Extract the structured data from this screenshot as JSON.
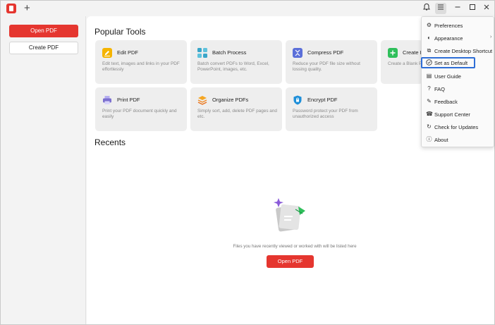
{
  "titlebar": {
    "new_tab_symbol": "+",
    "icons": [
      "pdf-app-logo",
      "bell-icon",
      "menu-icon",
      "minimize-icon",
      "maximize-icon",
      "close-icon"
    ]
  },
  "sidebar": {
    "open_pdf": "Open PDF",
    "create_pdf": "Create PDF"
  },
  "main": {
    "popular_tools_title": "Popular Tools",
    "tools": [
      {
        "title": "Edit PDF",
        "desc": "Edit text, images and links in your PDF effortlessly",
        "icon": "edit-icon",
        "color": "#f5b400"
      },
      {
        "title": "Batch Process",
        "desc": "Batch convert PDFs to Word, Excel, PowerPoint, images, etc.",
        "icon": "batch-icon",
        "color": "#3aa6c9"
      },
      {
        "title": "Compress PDF",
        "desc": "Reduce your PDF file size without lossing quality.",
        "icon": "compress-icon",
        "color": "#5b6fd9"
      },
      {
        "title": "Create PDF",
        "desc": "Create a Blank PDF",
        "icon": "create-icon",
        "color": "#2fbf5b"
      },
      {
        "title": "Print PDF",
        "desc": "Print your PDF document quickly and easily",
        "icon": "print-icon",
        "color": "#7b6fcf"
      },
      {
        "title": "Organize PDFs",
        "desc": "Simply sort, add, delete PDF pages and etc.",
        "icon": "organize-icon",
        "color": "#f08a24"
      },
      {
        "title": "Encrypt PDF",
        "desc": "Password protect your PDF from unauthorized access",
        "icon": "encrypt-icon",
        "color": "#1e8fd9"
      }
    ],
    "recents_title": "Recents",
    "empty_text": "Files you have recently viewed or worked with will be listed here",
    "open_pdf": "Open PDF"
  },
  "menu": {
    "items": [
      {
        "label": "Preferences",
        "icon": "gear-icon"
      },
      {
        "label": "Appearance",
        "icon": "palette-icon",
        "submenu": true
      },
      {
        "label": "Create Desktop Shortcut",
        "icon": "shortcut-icon"
      },
      {
        "label": "Set as Default",
        "icon": "check-circle-icon",
        "highlighted": true
      },
      {
        "label": "User Guide",
        "icon": "book-icon"
      },
      {
        "label": "FAQ",
        "icon": "question-icon"
      },
      {
        "label": "Feedback",
        "icon": "feedback-icon"
      },
      {
        "label": "Support Center",
        "icon": "support-icon"
      },
      {
        "label": "Check for Updates",
        "icon": "update-icon"
      },
      {
        "label": "About",
        "icon": "info-icon"
      }
    ]
  },
  "colors": {
    "accent": "#e5362f",
    "highlight_border": "#2f6ed6"
  }
}
